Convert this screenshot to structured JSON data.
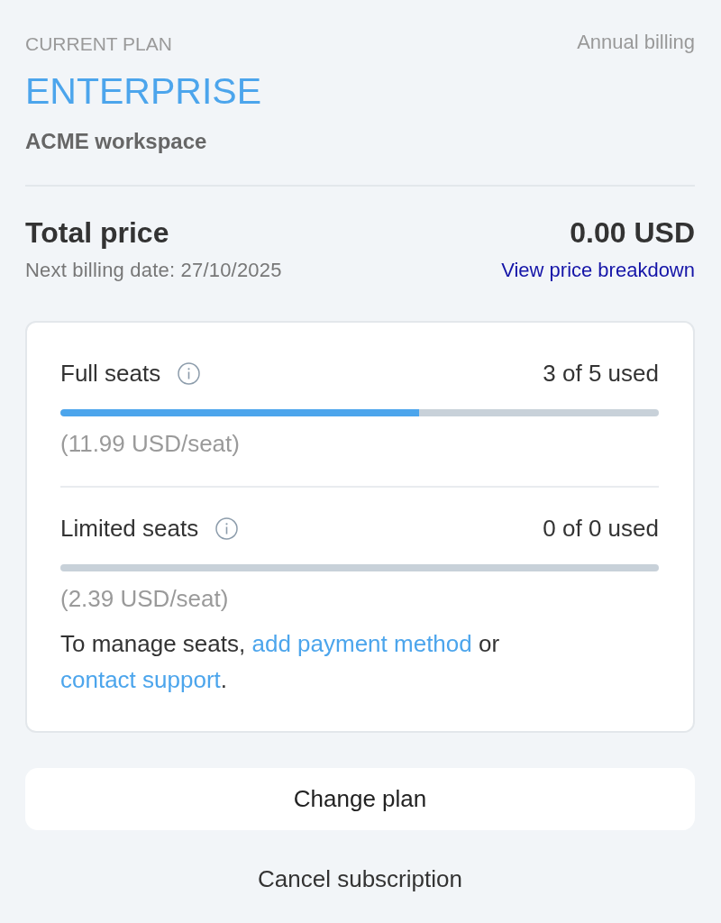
{
  "header": {
    "eyebrow": "CURRENT PLAN",
    "billing_cycle": "Annual billing",
    "plan_name": "ENTERPRISE",
    "workspace": "ACME workspace"
  },
  "total": {
    "label": "Total price",
    "amount": "0.00 USD",
    "next_billing": "Next billing date: 27/10/2025",
    "breakdown_link": "View price breakdown"
  },
  "seats": [
    {
      "label": "Full seats",
      "usage": "3 of 5 used",
      "level": 0.6,
      "price": "(11.99 USD/seat)"
    },
    {
      "label": "Limited seats",
      "usage": "0 of 0 used",
      "price": "(2.39 USD/seat)"
    }
  ],
  "notice": {
    "parts": [
      {
        "kind": "text",
        "text": "To manage seats, "
      },
      {
        "kind": "link",
        "text": "add payment method"
      },
      {
        "kind": "text",
        "text": " or "
      },
      {
        "kind": "link",
        "text": "contact support"
      },
      {
        "kind": "text",
        "text": "."
      }
    ]
  },
  "actions": [
    {
      "kind": "primary",
      "label": "Change plan"
    },
    {
      "kind": "text",
      "label": "Cancel subscription"
    }
  ]
}
